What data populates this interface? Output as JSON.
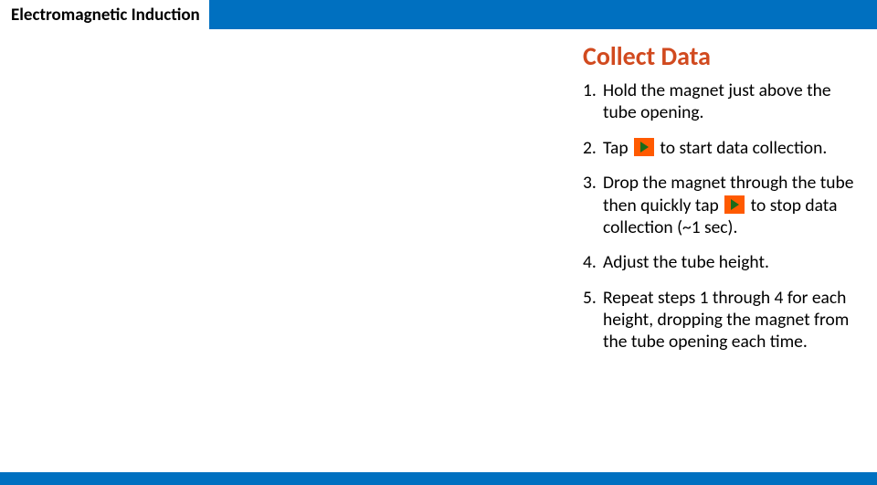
{
  "header": {
    "title": "Electromagnetic Induction"
  },
  "section": {
    "title": "Collect Data",
    "steps": {
      "s1": "Hold the magnet just above the tube opening.",
      "s2a": "Tap",
      "s2b": "to start data collection.",
      "s3a": "Drop the magnet through the tube then quickly tap",
      "s3b": "to stop data collection (~1 sec).",
      "s4": "Adjust the tube height.",
      "s5": "Repeat steps 1 through 4 for each height, dropping the magnet from the tube opening each time."
    }
  }
}
